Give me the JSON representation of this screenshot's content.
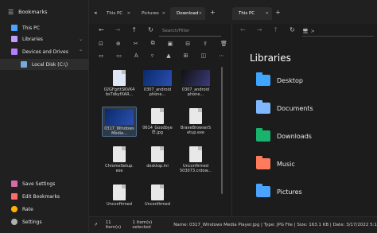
{
  "sidebar": {
    "title": "Bookmarks",
    "items": [
      {
        "label": "This PC"
      },
      {
        "label": "Libraries"
      },
      {
        "label": "Devices and Drives"
      },
      {
        "label": "Local Disk (C:\\)"
      }
    ],
    "bottom": [
      {
        "label": "Save Settings"
      },
      {
        "label": "Edit Bookmarks"
      },
      {
        "label": "Rate"
      },
      {
        "label": "Settings"
      }
    ]
  },
  "tabs": {
    "left": [
      {
        "label": "This PC"
      },
      {
        "label": "Pictures"
      },
      {
        "label": "Download"
      }
    ],
    "right": [
      {
        "label": "This PC"
      }
    ]
  },
  "left_pane": {
    "search_placeholder": "Search/Filter",
    "files": [
      {
        "name": "02GFgrttSKVK4\nbsTdkyfXAR...",
        "kind": "doc"
      },
      {
        "name": "0307_android\nphone...",
        "kind": "win",
        "caption": "Windows 11"
      },
      {
        "name": "0307_android\nphone...",
        "kind": "dark"
      },
      {
        "name": "0317_Windows\nMedia...",
        "kind": "win",
        "selected": true
      },
      {
        "name": "0614_Goodbye\nIE.jpg",
        "kind": "doc"
      },
      {
        "name": "BraveBrowserS\netup.exe",
        "kind": "doc"
      },
      {
        "name": "ChromeSetup.\nexe",
        "kind": "doc"
      },
      {
        "name": "desktop.ini",
        "kind": "doc"
      },
      {
        "name": "Unconfirmed\n503073.crdow...",
        "kind": "doc"
      },
      {
        "name": "Unconfirmed",
        "kind": "doc"
      },
      {
        "name": "Unconfirmed",
        "kind": "doc"
      }
    ]
  },
  "right_pane": {
    "path_chevron": ">",
    "title": "Libraries",
    "libraries": [
      {
        "label": "Desktop",
        "color": "#3ea6ff"
      },
      {
        "label": "Documents",
        "color": "#7fb8ff"
      },
      {
        "label": "Downloads",
        "color": "#19b36b"
      },
      {
        "label": "Music",
        "color": "#ff7b5c"
      },
      {
        "label": "Pictures",
        "color": "#4aa3ff"
      }
    ]
  },
  "status": {
    "items": "11 item(s)",
    "selected": "1 item(s) selected",
    "info": "Name: 0317_Windows Media Player.jpg | Type: JPG File | Size: 163.1 KB | Date: 3/17/2022 5:1"
  }
}
